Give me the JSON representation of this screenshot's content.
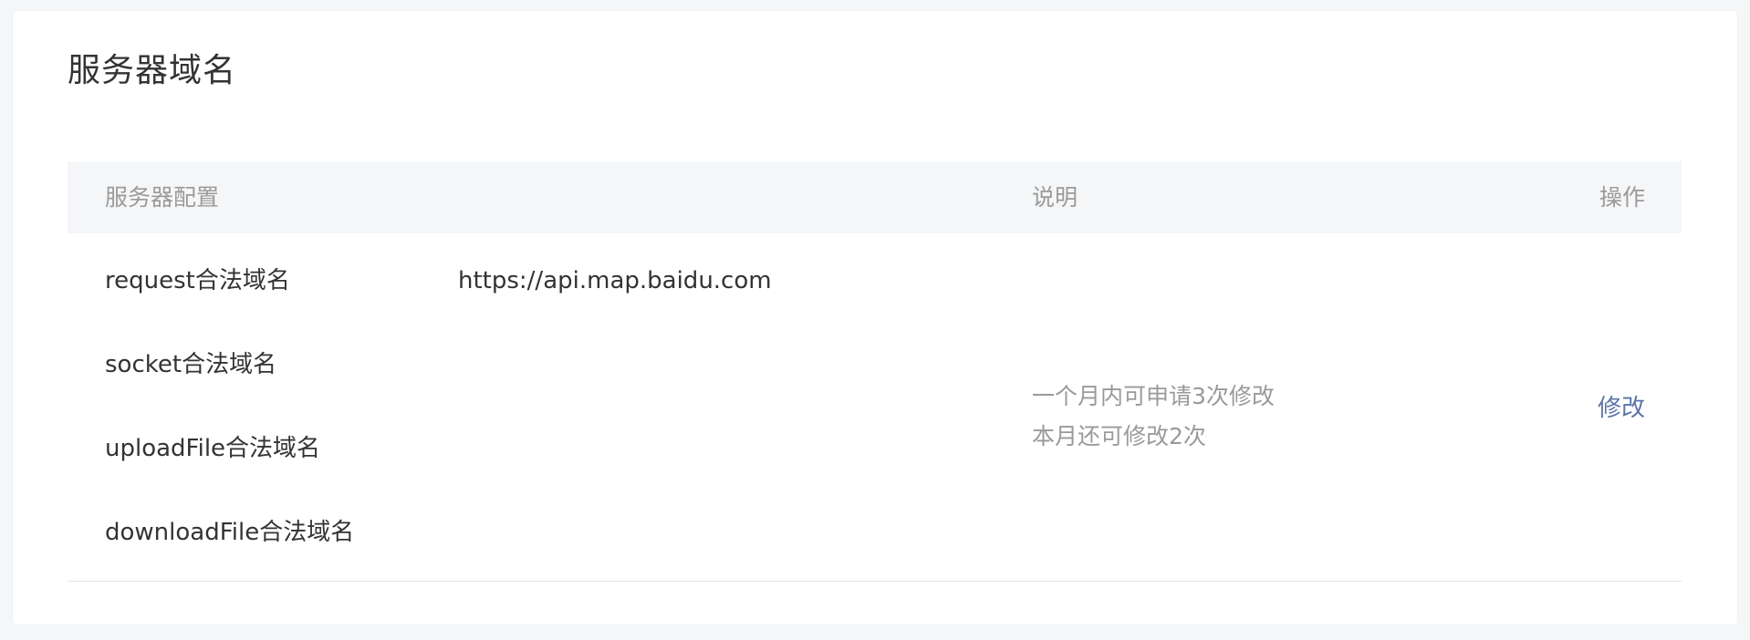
{
  "card": {
    "title": "服务器域名"
  },
  "table": {
    "headers": {
      "config": "服务器配置",
      "description": "说明",
      "operation": "操作"
    },
    "rows": [
      {
        "label": "request合法域名",
        "value": "https://api.map.baidu.com"
      },
      {
        "label": "socket合法域名",
        "value": ""
      },
      {
        "label": "uploadFile合法域名",
        "value": ""
      },
      {
        "label": "downloadFile合法域名",
        "value": ""
      }
    ],
    "description_lines": [
      "一个月内可申请3次修改",
      "本月还可修改2次"
    ],
    "action_label": "修改"
  },
  "colors": {
    "page_bg": "#f5f6f8",
    "card_bg": "#ffffff",
    "header_bg": "#f5f6f8",
    "text_primary": "#333333",
    "text_secondary": "#9a9a9a",
    "link": "#5b73a8"
  }
}
